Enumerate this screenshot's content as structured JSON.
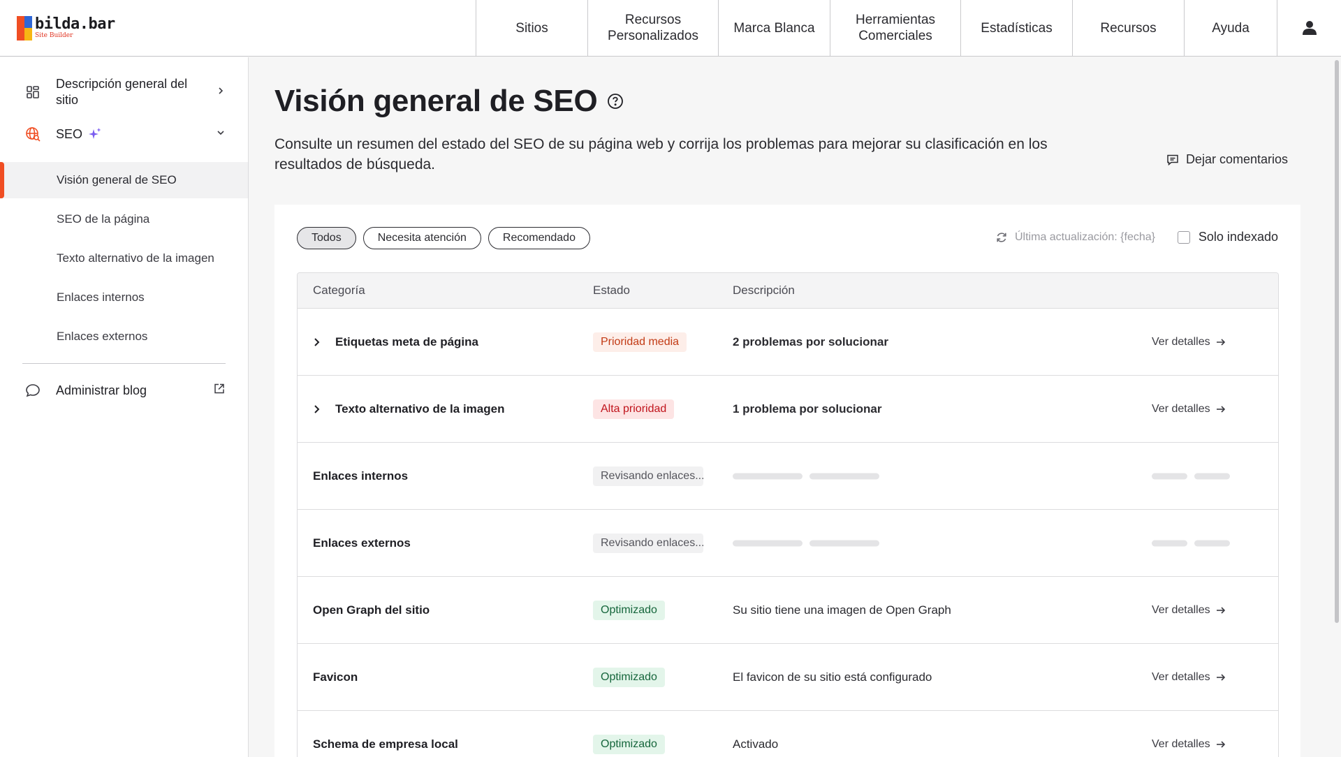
{
  "brand": {
    "name": "bilda.bar",
    "tagline": "Site Builder"
  },
  "nav": {
    "items": [
      {
        "label": "Sitios"
      },
      {
        "label": "Recursos Personalizados"
      },
      {
        "label": "Marca Blanca"
      },
      {
        "label": "Herramientas Comerciales"
      },
      {
        "label": "Estadísticas"
      },
      {
        "label": "Recursos"
      },
      {
        "label": "Ayuda"
      }
    ]
  },
  "sidebar": {
    "overview_label": "Descripción general del sitio",
    "seo_label": "SEO",
    "sub_items": [
      {
        "label": "Visión general de SEO"
      },
      {
        "label": "SEO de la página"
      },
      {
        "label": "Texto alternativo de la imagen"
      },
      {
        "label": "Enlaces internos"
      },
      {
        "label": "Enlaces externos"
      }
    ],
    "blog_label": "Administrar blog"
  },
  "page": {
    "title": "Visión general de SEO",
    "description": "Consulte un resumen del estado del SEO de su página web y corrija los problemas para mejorar su clasificación en los resultados de búsqueda.",
    "feedback_label": "Dejar comentarios"
  },
  "filters": {
    "chips": [
      {
        "label": "Todos"
      },
      {
        "label": "Necesita atención"
      },
      {
        "label": "Recomendado"
      }
    ],
    "last_updated": "Última actualización: {fecha}",
    "indexed_label": "Solo indexado"
  },
  "table": {
    "headers": {
      "category": "Categoría",
      "status": "Estado",
      "description": "Descripción"
    },
    "rows": [
      {
        "category": "Etiquetas meta de página",
        "status": "Prioridad media",
        "description": "2 problemas por solucionar",
        "action": "Ver detalles"
      },
      {
        "category": "Texto alternativo de la imagen",
        "status": "Alta prioridad",
        "description": "1 problema por solucionar",
        "action": "Ver detalles"
      },
      {
        "category": "Enlaces internos",
        "status": "Revisando enlaces..."
      },
      {
        "category": "Enlaces externos",
        "status": "Revisando enlaces..."
      },
      {
        "category": "Open Graph del sitio",
        "status": "Optimizado",
        "description": "Su sitio tiene una imagen de Open Graph",
        "action": "Ver detalles"
      },
      {
        "category": "Favicon",
        "status": "Optimizado",
        "description": "El favicon de su sitio está configurado",
        "action": "Ver detalles"
      },
      {
        "category": "Schema de empresa local",
        "status": "Optimizado",
        "description": "Activado",
        "action": "Ver detalles"
      }
    ]
  },
  "colors": {
    "accent": "#f04e23",
    "priority_medium": "#c23a14",
    "priority_high": "#c0141c",
    "optimized": "#16663c"
  }
}
